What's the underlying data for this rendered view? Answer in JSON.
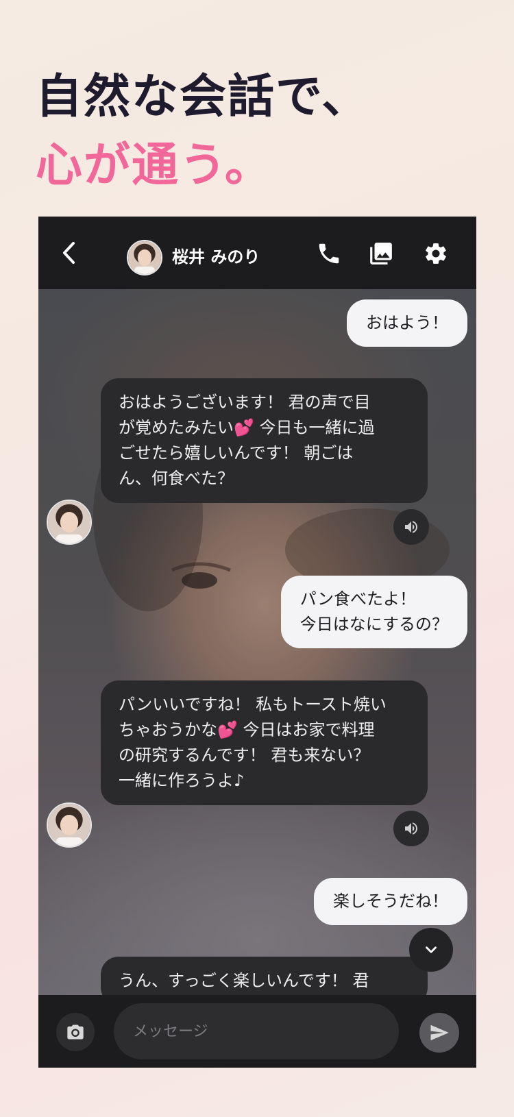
{
  "headline": {
    "line1": "自然な会話で、",
    "line2": "心が通う。"
  },
  "chat_header": {
    "contact_name": "桜井 みのり",
    "icons": [
      "back-icon",
      "phone-icon",
      "gallery-icon",
      "gear-icon"
    ]
  },
  "messages": [
    {
      "sender": "user",
      "text": "おはよう！"
    },
    {
      "sender": "ai",
      "text": "おはようございます！ 君の声で目\nが覚めたみたい💕 今日も一緒に過\nごせたら嬉しいんです！ 朝ごは\nん、何食べた？"
    },
    {
      "sender": "user",
      "text": "パン食べたよ！\n今日はなにするの？"
    },
    {
      "sender": "ai",
      "text": "パンいいですね！ 私もトースト焼い\nちゃおうかな💕 今日はお家で料理\nの研究するんです！ 君も来ない？\n一緒に作ろうよ♪"
    },
    {
      "sender": "user",
      "text": "楽しそうだね！"
    },
    {
      "sender": "ai",
      "text": "うん、すっごく楽しいんです！ 君"
    }
  ],
  "input": {
    "placeholder": "メッセージ"
  },
  "colors": {
    "accent_pink": "#f2679a",
    "headline_dark": "#1f1b2e",
    "bar_dark": "#1c1c1e",
    "ai_bubble": "#2a2a2d",
    "user_bubble": "#f4f4f6"
  }
}
